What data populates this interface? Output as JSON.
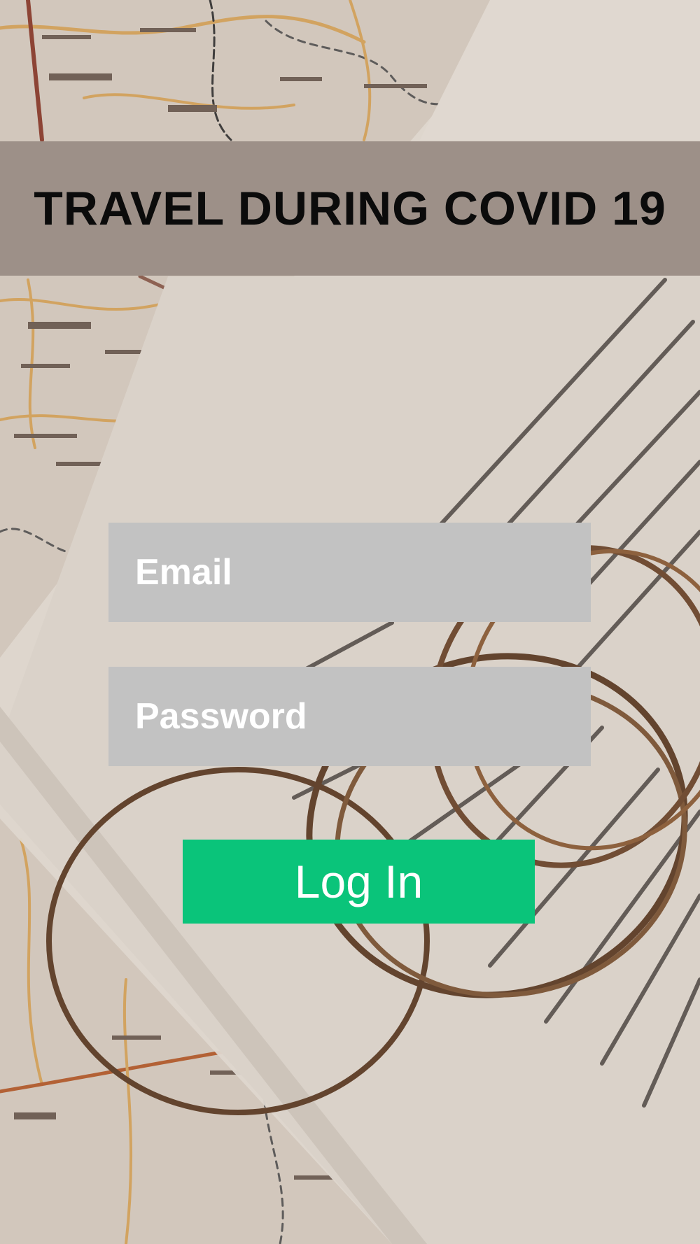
{
  "header": {
    "title": "TRAVEL DURING COVID 19"
  },
  "login_form": {
    "email_placeholder": "Email",
    "password_placeholder": "Password",
    "login_label": "Log In"
  },
  "colors": {
    "header_bar": "#9d9088",
    "input_background": "#c2c2c2",
    "login_button": "#0ac47a",
    "title_text": "#0b0b0b"
  }
}
